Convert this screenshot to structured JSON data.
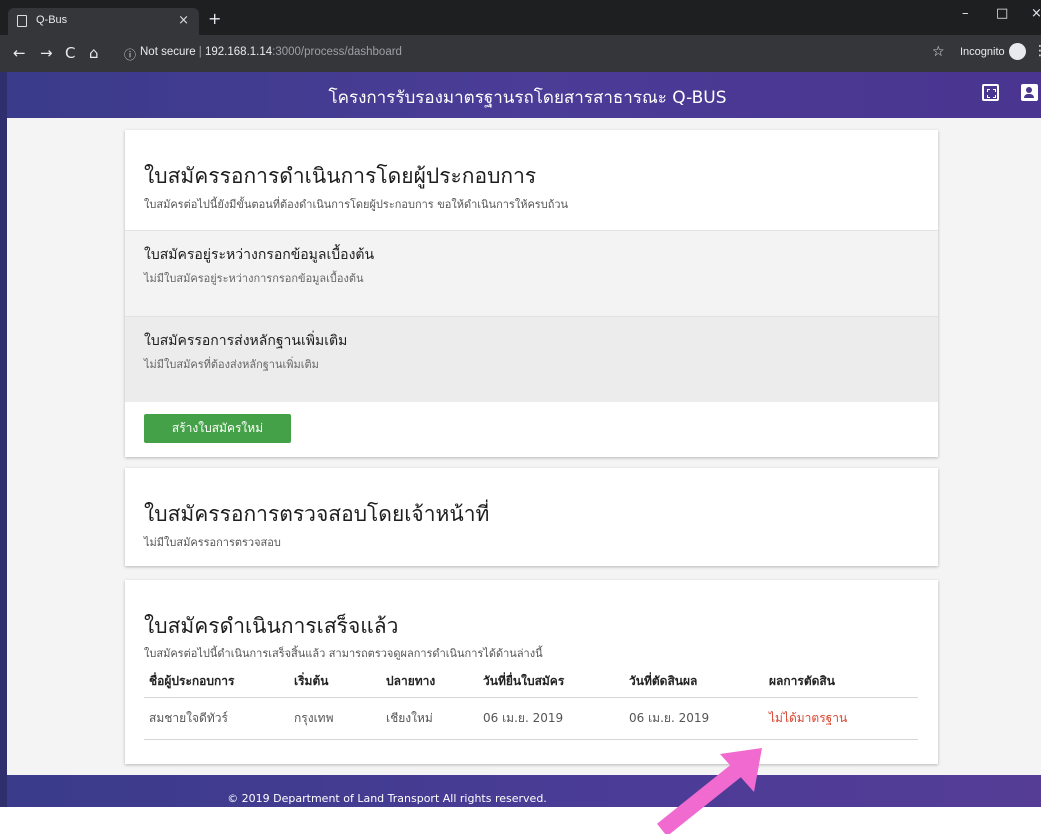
{
  "browser": {
    "tab_title": "Q-Bus",
    "tab_close": "×",
    "new_tab": "+",
    "url_host": "192.168.1.14",
    "url_rest": ":3000/process/dashboard",
    "security_label": "Not secure",
    "incognito_label": "Incognito",
    "win_min": "–",
    "win_max": "□",
    "win_close": "×"
  },
  "header": {
    "title": "โครงการรับรองมาตรฐานรถโดยสารสาธารณะ Q-BUS"
  },
  "operator_card": {
    "title": "ใบสมัครรอการดำเนินการโดยผู้ประกอบการ",
    "subtitle": "ใบสมัครต่อไปนี้ยังมีขั้นตอนที่ต้องดำเนินการโดยผู้ประกอบการ ขอให้ดำเนินการให้ครบถ้วน",
    "sections": [
      {
        "title": "ใบสมัครอยู่ระหว่างกรอกข้อมูลเบื้องต้น",
        "subtitle": "ไม่มีใบสมัครอยู่ระหว่างการกรอกข้อมูลเบื้องต้น"
      },
      {
        "title": "ใบสมัครรอการส่งหลักฐานเพิ่มเติม",
        "subtitle": "ไม่มีใบสมัครที่ต้องส่งหลักฐานเพิ่มเติม"
      }
    ],
    "new_button": "สร้างใบสมัครใหม่"
  },
  "inspection_card": {
    "title": "ใบสมัครรอการตรวจสอบโดยเจ้าหน้าที่",
    "subtitle": "ไม่มีใบสมัครรอการตรวจสอบ"
  },
  "completed_card": {
    "title": "ใบสมัครดำเนินการเสร็จแล้ว",
    "subtitle": "ใบสมัครต่อไปนี้ดำเนินการเสร็จสิ้นแล้ว สามารถตรวจดูผลการดำเนินการได้ด้านล่างนี้",
    "columns": [
      "ชื่อผู้ประกอบการ",
      "เริ่มต้น",
      "ปลายทาง",
      "วันที่ยื่นใบสมัคร",
      "วันที่ตัดสินผล",
      "ผลการตัดสิน"
    ],
    "rows": [
      [
        "สมชายใจดีทัวร์",
        "กรุงเทพ",
        "เชียงใหม่",
        "06 เม.ย. 2019",
        "06 เม.ย. 2019",
        "ไม่ได้มาตรฐาน"
      ]
    ]
  },
  "footer": {
    "text": "© 2019 Department of Land Transport All rights reserved."
  },
  "colors": {
    "header": "#4a3a92",
    "primary_button": "#45a147",
    "fail": "#d9452f",
    "annotation_arrow": "#f06ad0"
  }
}
